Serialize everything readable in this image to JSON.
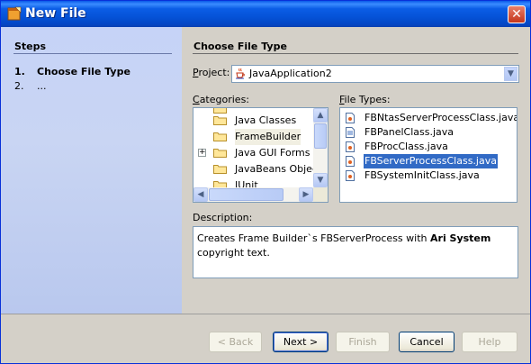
{
  "window": {
    "title": "New File",
    "close_glyph": "✕"
  },
  "steps": {
    "title": "Steps",
    "items": [
      {
        "num": "1.",
        "label": "Choose File Type",
        "active": true
      },
      {
        "num": "2.",
        "label": "...",
        "active": false
      }
    ]
  },
  "main": {
    "title": "Choose File Type",
    "project_label_key": "P",
    "project_label_rest": "roject:",
    "project_value": "JavaApplication2",
    "categories_label_key": "C",
    "categories_label_rest": "ategories:",
    "categories": [
      {
        "label": "Java Classes",
        "expandable": false,
        "selected": false
      },
      {
        "label": "FrameBuilder",
        "expandable": false,
        "selected": true
      },
      {
        "label": "Java GUI Forms",
        "expandable": true,
        "selected": false
      },
      {
        "label": "JavaBeans Object",
        "expandable": false,
        "selected": false
      },
      {
        "label": "JUnit",
        "expandable": false,
        "selected": false
      }
    ],
    "file_types_label_key": "F",
    "file_types_label_rest": "ile Types:",
    "file_types": [
      {
        "label": "FBNtasServerProcessClass.java",
        "selected": false
      },
      {
        "label": "FBPanelClass.java",
        "selected": false
      },
      {
        "label": "FBProcClass.java",
        "selected": false
      },
      {
        "label": "FBServerProcessClass.java",
        "selected": true
      },
      {
        "label": "FBSystemInitClass.java",
        "selected": false
      }
    ],
    "description_label": "Description:",
    "description_before": "Creates Frame Builder`s FBServerProcess with ",
    "description_bold": "Ari System",
    "description_after": " copyright text."
  },
  "buttons": {
    "back": "< Back",
    "next": "Next >",
    "finish": "Finish",
    "cancel": "Cancel",
    "help": "Help"
  },
  "colors": {
    "selection": "#316ac5",
    "title_bar": "#0553d8",
    "steps_bg": "#c6d3f7"
  }
}
